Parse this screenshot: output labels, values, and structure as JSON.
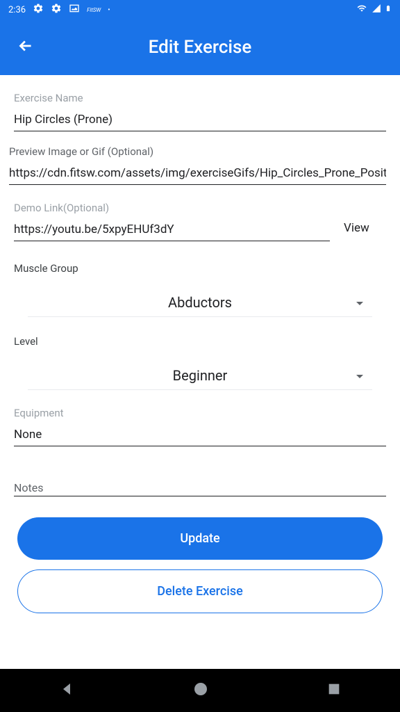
{
  "status": {
    "time": "2:36",
    "app_badge": "FitSW"
  },
  "header": {
    "title": "Edit Exercise"
  },
  "fields": {
    "exercise_name_label": "Exercise Name",
    "exercise_name_value": "Hip Circles (Prone)",
    "preview_label": "Preview Image or Gif (Optional)",
    "preview_value": "https://cdn.fitsw.com/assets/img/exerciseGifs/Hip_Circles_Prone_Posit",
    "demo_label": "Demo Link(Optional)",
    "demo_value": "https://youtu.be/5xpyEHUf3dY",
    "view_label": "View",
    "muscle_group_label": "Muscle Group",
    "muscle_group_value": "Abductors",
    "level_label": "Level",
    "level_value": "Beginner",
    "equipment_label": "Equipment",
    "equipment_value": "None",
    "notes_label": "Notes",
    "notes_value": ""
  },
  "buttons": {
    "update": "Update",
    "delete": "Delete Exercise"
  }
}
